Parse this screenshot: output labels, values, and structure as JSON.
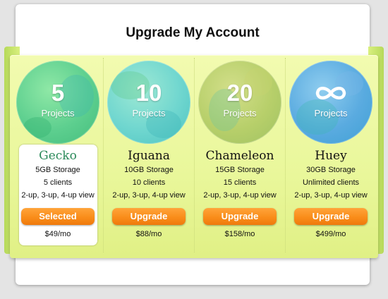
{
  "title": "Upgrade My Account",
  "plans": [
    {
      "number": "5",
      "projects": "Projects",
      "name": "Gecko",
      "storage": "5GB Storage",
      "clients": "5 clients",
      "views": "2-up, 3-up, 4-up view",
      "button": "Selected",
      "price": "$49/mo",
      "selected": true,
      "circle_color": "#5dcf8f"
    },
    {
      "number": "10",
      "projects": "Projects",
      "name": "Iguana",
      "storage": "10GB Storage",
      "clients": "10 clients",
      "views": "2-up, 3-up, 4-up view",
      "button": "Upgrade",
      "price": "$88/mo",
      "selected": false,
      "circle_color": "#6fd6cf"
    },
    {
      "number": "20",
      "projects": "Projects",
      "name": "Chameleon",
      "storage": "15GB Storage",
      "clients": "15 clients",
      "views": "2-up, 3-up, 4-up view",
      "button": "Upgrade",
      "price": "$158/mo",
      "selected": false,
      "circle_color": "#b7cf6a"
    },
    {
      "number": "",
      "projects": "Projects",
      "name": "Huey",
      "storage": "30GB Storage",
      "clients": "Unlimited clients",
      "views": "2-up, 3-up, 4-up view",
      "button": "Upgrade",
      "price": "$499/mo",
      "selected": false,
      "icon": "infinity-icon",
      "circle_color": "#5aabe0"
    }
  ],
  "colors": {
    "accent_button": "#f98d1a",
    "ribbon": "#e9f79a",
    "selected_name": "#2b8a5a"
  }
}
